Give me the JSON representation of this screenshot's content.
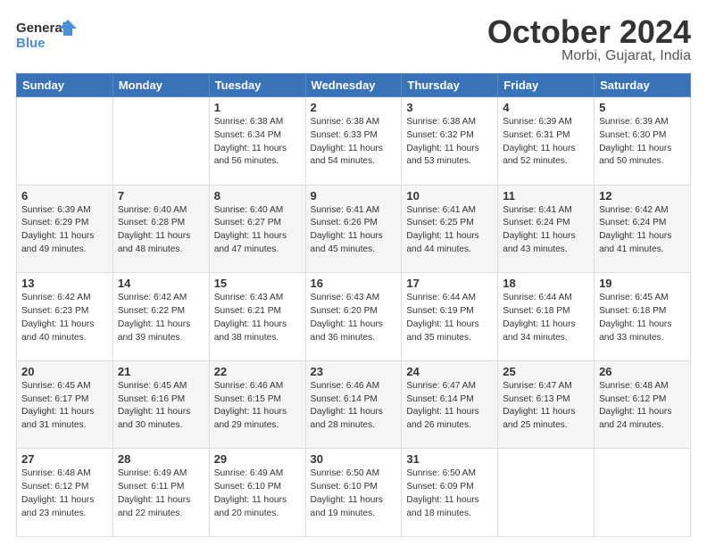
{
  "header": {
    "logo_line1": "General",
    "logo_line2": "Blue",
    "month": "October 2024",
    "location": "Morbi, Gujarat, India"
  },
  "days_of_week": [
    "Sunday",
    "Monday",
    "Tuesday",
    "Wednesday",
    "Thursday",
    "Friday",
    "Saturday"
  ],
  "weeks": [
    [
      {
        "day": "",
        "info": ""
      },
      {
        "day": "",
        "info": ""
      },
      {
        "day": "1",
        "info": "Sunrise: 6:38 AM\nSunset: 6:34 PM\nDaylight: 11 hours and 56 minutes."
      },
      {
        "day": "2",
        "info": "Sunrise: 6:38 AM\nSunset: 6:33 PM\nDaylight: 11 hours and 54 minutes."
      },
      {
        "day": "3",
        "info": "Sunrise: 6:38 AM\nSunset: 6:32 PM\nDaylight: 11 hours and 53 minutes."
      },
      {
        "day": "4",
        "info": "Sunrise: 6:39 AM\nSunset: 6:31 PM\nDaylight: 11 hours and 52 minutes."
      },
      {
        "day": "5",
        "info": "Sunrise: 6:39 AM\nSunset: 6:30 PM\nDaylight: 11 hours and 50 minutes."
      }
    ],
    [
      {
        "day": "6",
        "info": "Sunrise: 6:39 AM\nSunset: 6:29 PM\nDaylight: 11 hours and 49 minutes."
      },
      {
        "day": "7",
        "info": "Sunrise: 6:40 AM\nSunset: 6:28 PM\nDaylight: 11 hours and 48 minutes."
      },
      {
        "day": "8",
        "info": "Sunrise: 6:40 AM\nSunset: 6:27 PM\nDaylight: 11 hours and 47 minutes."
      },
      {
        "day": "9",
        "info": "Sunrise: 6:41 AM\nSunset: 6:26 PM\nDaylight: 11 hours and 45 minutes."
      },
      {
        "day": "10",
        "info": "Sunrise: 6:41 AM\nSunset: 6:25 PM\nDaylight: 11 hours and 44 minutes."
      },
      {
        "day": "11",
        "info": "Sunrise: 6:41 AM\nSunset: 6:24 PM\nDaylight: 11 hours and 43 minutes."
      },
      {
        "day": "12",
        "info": "Sunrise: 6:42 AM\nSunset: 6:24 PM\nDaylight: 11 hours and 41 minutes."
      }
    ],
    [
      {
        "day": "13",
        "info": "Sunrise: 6:42 AM\nSunset: 6:23 PM\nDaylight: 11 hours and 40 minutes."
      },
      {
        "day": "14",
        "info": "Sunrise: 6:42 AM\nSunset: 6:22 PM\nDaylight: 11 hours and 39 minutes."
      },
      {
        "day": "15",
        "info": "Sunrise: 6:43 AM\nSunset: 6:21 PM\nDaylight: 11 hours and 38 minutes."
      },
      {
        "day": "16",
        "info": "Sunrise: 6:43 AM\nSunset: 6:20 PM\nDaylight: 11 hours and 36 minutes."
      },
      {
        "day": "17",
        "info": "Sunrise: 6:44 AM\nSunset: 6:19 PM\nDaylight: 11 hours and 35 minutes."
      },
      {
        "day": "18",
        "info": "Sunrise: 6:44 AM\nSunset: 6:18 PM\nDaylight: 11 hours and 34 minutes."
      },
      {
        "day": "19",
        "info": "Sunrise: 6:45 AM\nSunset: 6:18 PM\nDaylight: 11 hours and 33 minutes."
      }
    ],
    [
      {
        "day": "20",
        "info": "Sunrise: 6:45 AM\nSunset: 6:17 PM\nDaylight: 11 hours and 31 minutes."
      },
      {
        "day": "21",
        "info": "Sunrise: 6:45 AM\nSunset: 6:16 PM\nDaylight: 11 hours and 30 minutes."
      },
      {
        "day": "22",
        "info": "Sunrise: 6:46 AM\nSunset: 6:15 PM\nDaylight: 11 hours and 29 minutes."
      },
      {
        "day": "23",
        "info": "Sunrise: 6:46 AM\nSunset: 6:14 PM\nDaylight: 11 hours and 28 minutes."
      },
      {
        "day": "24",
        "info": "Sunrise: 6:47 AM\nSunset: 6:14 PM\nDaylight: 11 hours and 26 minutes."
      },
      {
        "day": "25",
        "info": "Sunrise: 6:47 AM\nSunset: 6:13 PM\nDaylight: 11 hours and 25 minutes."
      },
      {
        "day": "26",
        "info": "Sunrise: 6:48 AM\nSunset: 6:12 PM\nDaylight: 11 hours and 24 minutes."
      }
    ],
    [
      {
        "day": "27",
        "info": "Sunrise: 6:48 AM\nSunset: 6:12 PM\nDaylight: 11 hours and 23 minutes."
      },
      {
        "day": "28",
        "info": "Sunrise: 6:49 AM\nSunset: 6:11 PM\nDaylight: 11 hours and 22 minutes."
      },
      {
        "day": "29",
        "info": "Sunrise: 6:49 AM\nSunset: 6:10 PM\nDaylight: 11 hours and 20 minutes."
      },
      {
        "day": "30",
        "info": "Sunrise: 6:50 AM\nSunset: 6:10 PM\nDaylight: 11 hours and 19 minutes."
      },
      {
        "day": "31",
        "info": "Sunrise: 6:50 AM\nSunset: 6:09 PM\nDaylight: 11 hours and 18 minutes."
      },
      {
        "day": "",
        "info": ""
      },
      {
        "day": "",
        "info": ""
      }
    ]
  ]
}
